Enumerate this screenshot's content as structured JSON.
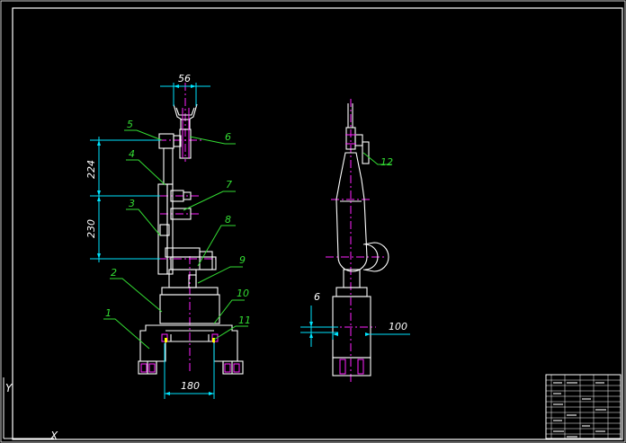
{
  "colors": {
    "background": "#000000",
    "outline": "#ffffff",
    "dimension": "#00e5ff",
    "leader": "#33dd33",
    "centerline": "#ff22ff",
    "accent": "#ffff00"
  },
  "dimensions": {
    "top_width": "56",
    "upper_height": "224",
    "lower_height": "230",
    "base_width": "180",
    "side_small": "6",
    "side_width": "100"
  },
  "part_labels": [
    "1",
    "2",
    "3",
    "4",
    "5",
    "6",
    "7",
    "8",
    "9",
    "10",
    "11",
    "12"
  ],
  "ucs": {
    "axis_y": "Y",
    "axis_x": "X"
  }
}
